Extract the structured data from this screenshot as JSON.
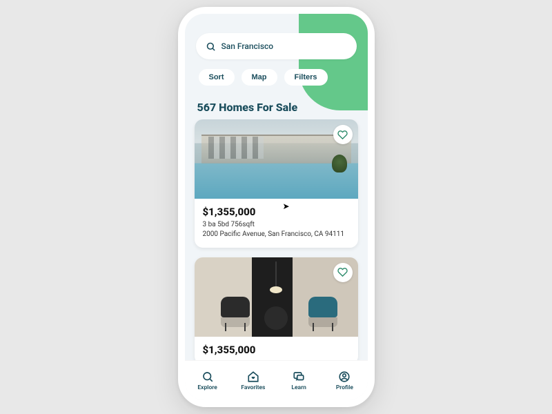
{
  "colors": {
    "accent": "#64c88a",
    "ink": "#1a4d5c"
  },
  "search": {
    "query": "San Francisco"
  },
  "chips": {
    "sort": "Sort",
    "map": "Map",
    "filters": "Filters"
  },
  "results_heading": "567 Homes For Sale",
  "listings": [
    {
      "price": "$1,355,000",
      "specs": "3 ba 5bd 756sqft",
      "address": "2000 Pacific Avenue, San Francisco, CA 94111"
    },
    {
      "price": "$1,355,000",
      "specs": "",
      "address": ""
    }
  ],
  "nav": {
    "explore": "Explore",
    "favorites": "Favorites",
    "learn": "Learn",
    "profile": "Profile"
  }
}
